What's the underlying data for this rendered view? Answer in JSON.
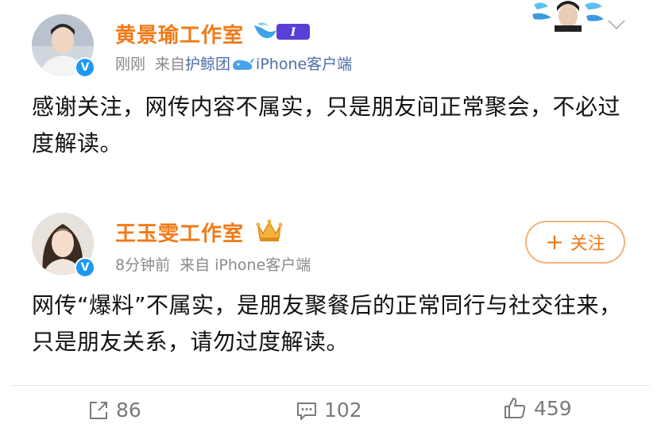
{
  "post1": {
    "author_name": "黄景瑜工作室",
    "verified_mark": "V",
    "level_badge_text": "I",
    "time": "刚刚",
    "source_prefix": "来自",
    "source_name": "护鲸团",
    "client": "iPhone客户端",
    "content": "感谢关注，网传内容不属实，只是朋友间正常聚会，不必过度解读。"
  },
  "post2": {
    "author_name": "王玉雯工作室",
    "verified_mark": "V",
    "time": "8分钟前",
    "source": "来自 iPhone客户端",
    "follow_plus": "+",
    "follow_label": "关注",
    "content": "网传“爆料”不属实，是朋友聚餐后的正常同行与社交往来，只是朋友关系，请勿过度解读。"
  },
  "actions": {
    "share_count": "86",
    "comment_count": "102",
    "like_count": "459"
  },
  "colors": {
    "name_orange": "#f07a17",
    "verified_blue": "#1d97f4",
    "meta_gray": "#8a8a8a",
    "link_blue": "#4a6ea8"
  },
  "icons": [
    "whale-icon",
    "crown-icon",
    "chevron-down-icon",
    "share-icon",
    "comment-icon",
    "like-icon",
    "level-badge-icon"
  ]
}
